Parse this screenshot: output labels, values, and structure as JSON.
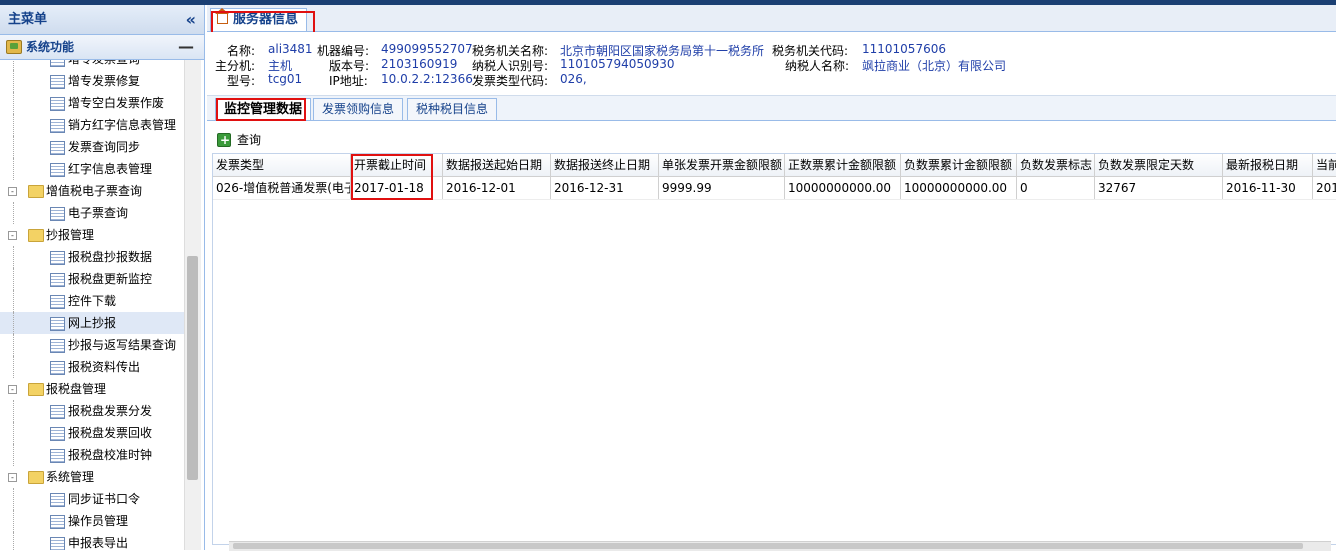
{
  "sidebar": {
    "title": "主菜单",
    "collapse_glyph": "«",
    "group": "系统功能",
    "group_toggle": "—",
    "nodes": [
      {
        "type": "leaf",
        "label": "增专发票查询"
      },
      {
        "type": "leaf",
        "label": "增专发票修复"
      },
      {
        "type": "leaf",
        "label": "增专空白发票作废"
      },
      {
        "type": "leaf",
        "label": "销方红字信息表管理"
      },
      {
        "type": "leaf",
        "label": "发票查询同步"
      },
      {
        "type": "leaf",
        "label": "红字信息表管理"
      },
      {
        "type": "folder",
        "label": "增值税电子票查询"
      },
      {
        "type": "leaf",
        "label": "电子票查询"
      },
      {
        "type": "folder",
        "label": "抄报管理"
      },
      {
        "type": "leaf",
        "label": "报税盘抄报数据"
      },
      {
        "type": "leaf",
        "label": "报税盘更新监控"
      },
      {
        "type": "leaf",
        "label": "控件下载"
      },
      {
        "type": "leaf",
        "label": "网上抄报",
        "selected": true
      },
      {
        "type": "leaf",
        "label": "抄报与返写结果查询"
      },
      {
        "type": "leaf",
        "label": "报税资料传出"
      },
      {
        "type": "folder",
        "label": "报税盘管理"
      },
      {
        "type": "leaf",
        "label": "报税盘发票分发"
      },
      {
        "type": "leaf",
        "label": "报税盘发票回收"
      },
      {
        "type": "leaf",
        "label": "报税盘校准时钟"
      },
      {
        "type": "folder",
        "label": "系统管理"
      },
      {
        "type": "leaf",
        "label": "同步证书口令"
      },
      {
        "type": "leaf",
        "label": "操作员管理"
      },
      {
        "type": "leaf",
        "label": "申报表导出"
      }
    ]
  },
  "main": {
    "tab_title": "服务器信息",
    "info": {
      "name_label": "名称:",
      "name": "ali3481",
      "machine_label": "机器编号:",
      "machine": "499099552707",
      "taxoffice_label": "税务机关名称:",
      "taxoffice": "北京市朝阳区国家税务局第十一税务所",
      "taxcode_label": "税务机关代码:",
      "taxcode": "11101057606",
      "branch_label": "主分机:",
      "branch": "主机",
      "version_label": "版本号:",
      "version": "2103160919",
      "taxpayerid_label": "纳税人识别号:",
      "taxpayerid": "110105794050930",
      "taxpayer_label": "纳税人名称:",
      "taxpayer": "飒拉商业（北京）有限公司",
      "model_label": "型号:",
      "model": "tcg01",
      "ip_label": "IP地址:",
      "ip": "10.0.2.2:12366",
      "invtype_label": "发票类型代码:",
      "invtype": "026,"
    },
    "subtabs": [
      "监控管理数据",
      "发票领购信息",
      "税种税目信息"
    ],
    "query_label": "查询",
    "grid": {
      "columns": [
        "发票类型",
        "开票截止时间",
        "数据报送起始日期",
        "数据报送终止日期",
        "单张发票开票金额限额",
        "正数票累计金额限额",
        "负数票累计金额限额",
        "负数发票标志",
        "负数发票限定天数",
        "最新报税日期",
        "当前"
      ],
      "rows": [
        [
          "026-增值税普通发票(电子",
          "2017-01-18",
          "2016-12-01",
          "2016-12-31",
          "9999.99",
          "10000000000.00",
          "10000000000.00",
          "0",
          "32767",
          "2016-11-30",
          "201"
        ]
      ]
    }
  }
}
